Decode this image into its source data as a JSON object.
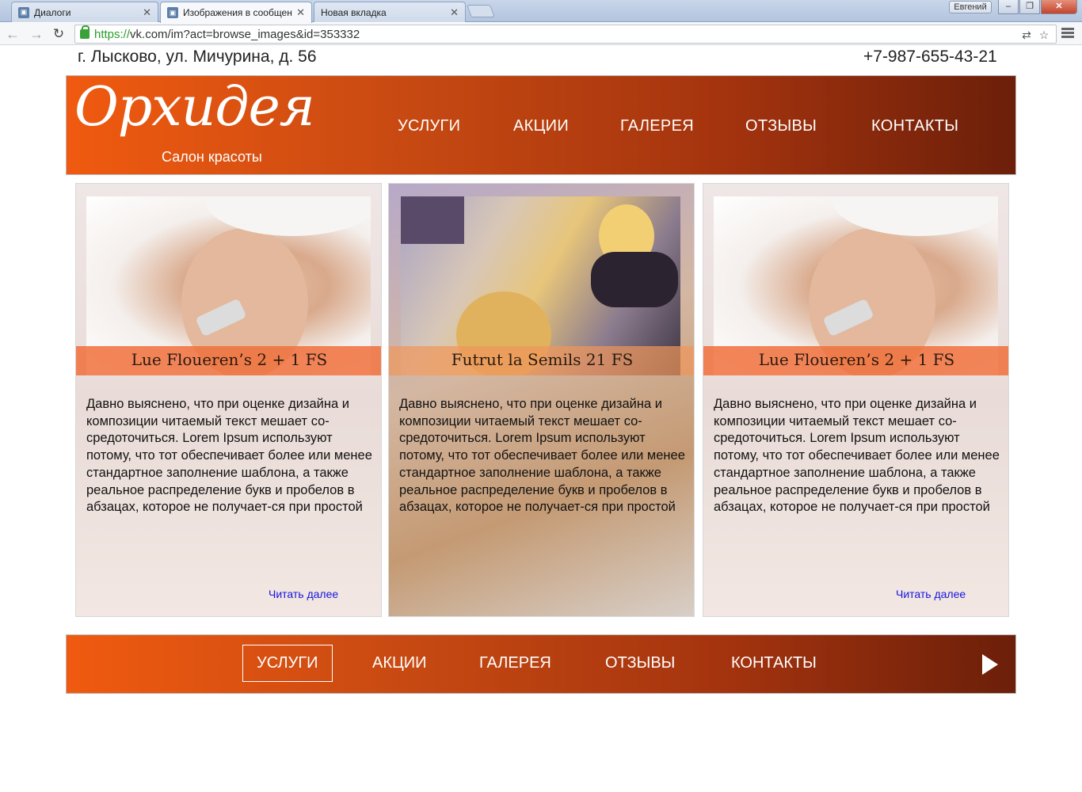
{
  "browser": {
    "tabs": [
      {
        "label": "Диалоги"
      },
      {
        "label": "Изображения в сообщен"
      },
      {
        "label": "Новая вкладка"
      }
    ],
    "user": "Евгений",
    "url_scheme": "https://",
    "url_rest": "vk.com/im?act=browse_images&id=353332"
  },
  "site": {
    "address": "г. Лысково, ул. Мичурина, д. 56",
    "phone": "+7-987-655-43-21",
    "logo_title": "Орхидея",
    "logo_subtitle": "Салон красоты",
    "nav": [
      "УСЛУГИ",
      "АКЦИИ",
      "ГАЛЕРЕЯ",
      "ОТЗЫВЫ",
      "КОНТАКТЫ"
    ],
    "cards": [
      {
        "title": "Lue Floueren’s 2 + 1 FS",
        "text": "Давно выяснено, что при оценке дизайна и композиции читаемый текст мешает со-средоточиться. Lorem Ipsum используют потому, что тот обеспечивает более или менее стандартное заполнение шаблона, а также реальное распределение букв и пробелов в абзацах, которое не получает-ся при простой",
        "link": "Читать далее"
      },
      {
        "title": "Futrut la Semils 21 FS",
        "text": "Давно выяснено, что при оценке дизайна и композиции читаемый текст мешает со-средоточиться. Lorem Ipsum используют потому, что тот обеспечивает более или менее стандартное заполнение шаблона, а также реальное распределение букв и пробелов в абзацах, которое не получает-ся при простой",
        "link": ""
      },
      {
        "title": "Lue Floueren’s 2 + 1 FS",
        "text": "Давно выяснено, что при оценке дизайна и композиции читаемый текст мешает со-средоточиться. Lorem Ipsum используют потому, что тот обеспечивает более или менее стандартное заполнение шаблона, а также реальное распределение букв и пробелов в абзацах, которое не получает-ся при простой",
        "link": "Читать далее"
      }
    ],
    "footer_nav": [
      "УСЛУГИ",
      "АКЦИИ",
      "ГАЛЕРЕЯ",
      "ОТЗЫВЫ",
      "КОНТАКТЫ"
    ]
  },
  "colors": {
    "accent_orange": "#f05a10",
    "accent_dark": "#6c1f0a",
    "link_blue": "#1515e0"
  }
}
